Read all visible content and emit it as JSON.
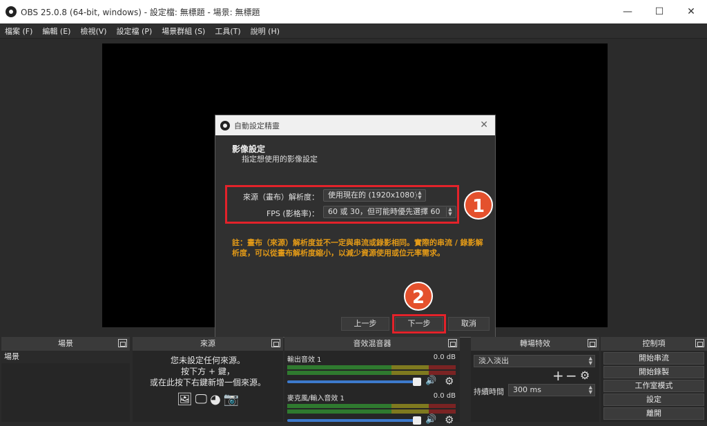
{
  "window": {
    "title": "OBS 25.0.8 (64-bit, windows) - 設定檔: 無標題 - 場景: 無標題",
    "minimize": "—",
    "maximize": "☐",
    "close": "✕"
  },
  "menu": [
    "檔案 (F)",
    "編輯 (E)",
    "檢視(V)",
    "設定檔 (P)",
    "場景群組 (S)",
    "工具(T)",
    "說明 (H)"
  ],
  "dialog": {
    "title": "自動設定精靈",
    "close": "✕",
    "heading": "影像設定",
    "subheading": "指定想使用的影像設定",
    "resolution_label": "來源（畫布）解析度：",
    "resolution_value": "使用現在的 (1920x1080)",
    "fps_label": "FPS (影格率)：",
    "fps_value": "60 或 30，但可能時優先選擇 60",
    "note": "註：畫布（來源）解析度並不一定與串流或錄影相同。實際的串流 / 錄影解析度，可以從畫布解析度縮小，以減少資源使用或位元率需求。",
    "back_button": "上一步",
    "next_button": "下一步",
    "cancel_button": "取消",
    "highlight_color": "#e3222a"
  },
  "badges": {
    "one": "1",
    "two": "2",
    "color": "#e4512d"
  },
  "docks": {
    "scenes": {
      "header": "場景",
      "items": [
        "場景"
      ]
    },
    "sources": {
      "header": "來源",
      "empty_line1": "您未設定任何來源。",
      "empty_line2": "按下方 + 鍵，",
      "empty_line3": "或在此按下右鍵新增一個來源。"
    },
    "mixer": {
      "header": "音效混音器",
      "channels": [
        {
          "name": "輸出音效 1",
          "db": "0.0 dB"
        },
        {
          "name": "麥克風/輸入音效 1",
          "db": "0.0 dB"
        }
      ]
    },
    "transitions": {
      "header": "轉場特效",
      "transition_value": "淡入淡出",
      "duration_label": "持續時間",
      "duration_value": "300 ms"
    },
    "controls": {
      "header": "控制項",
      "buttons": [
        "開始串流",
        "開始錄製",
        "工作室模式",
        "設定",
        "離開"
      ]
    }
  }
}
